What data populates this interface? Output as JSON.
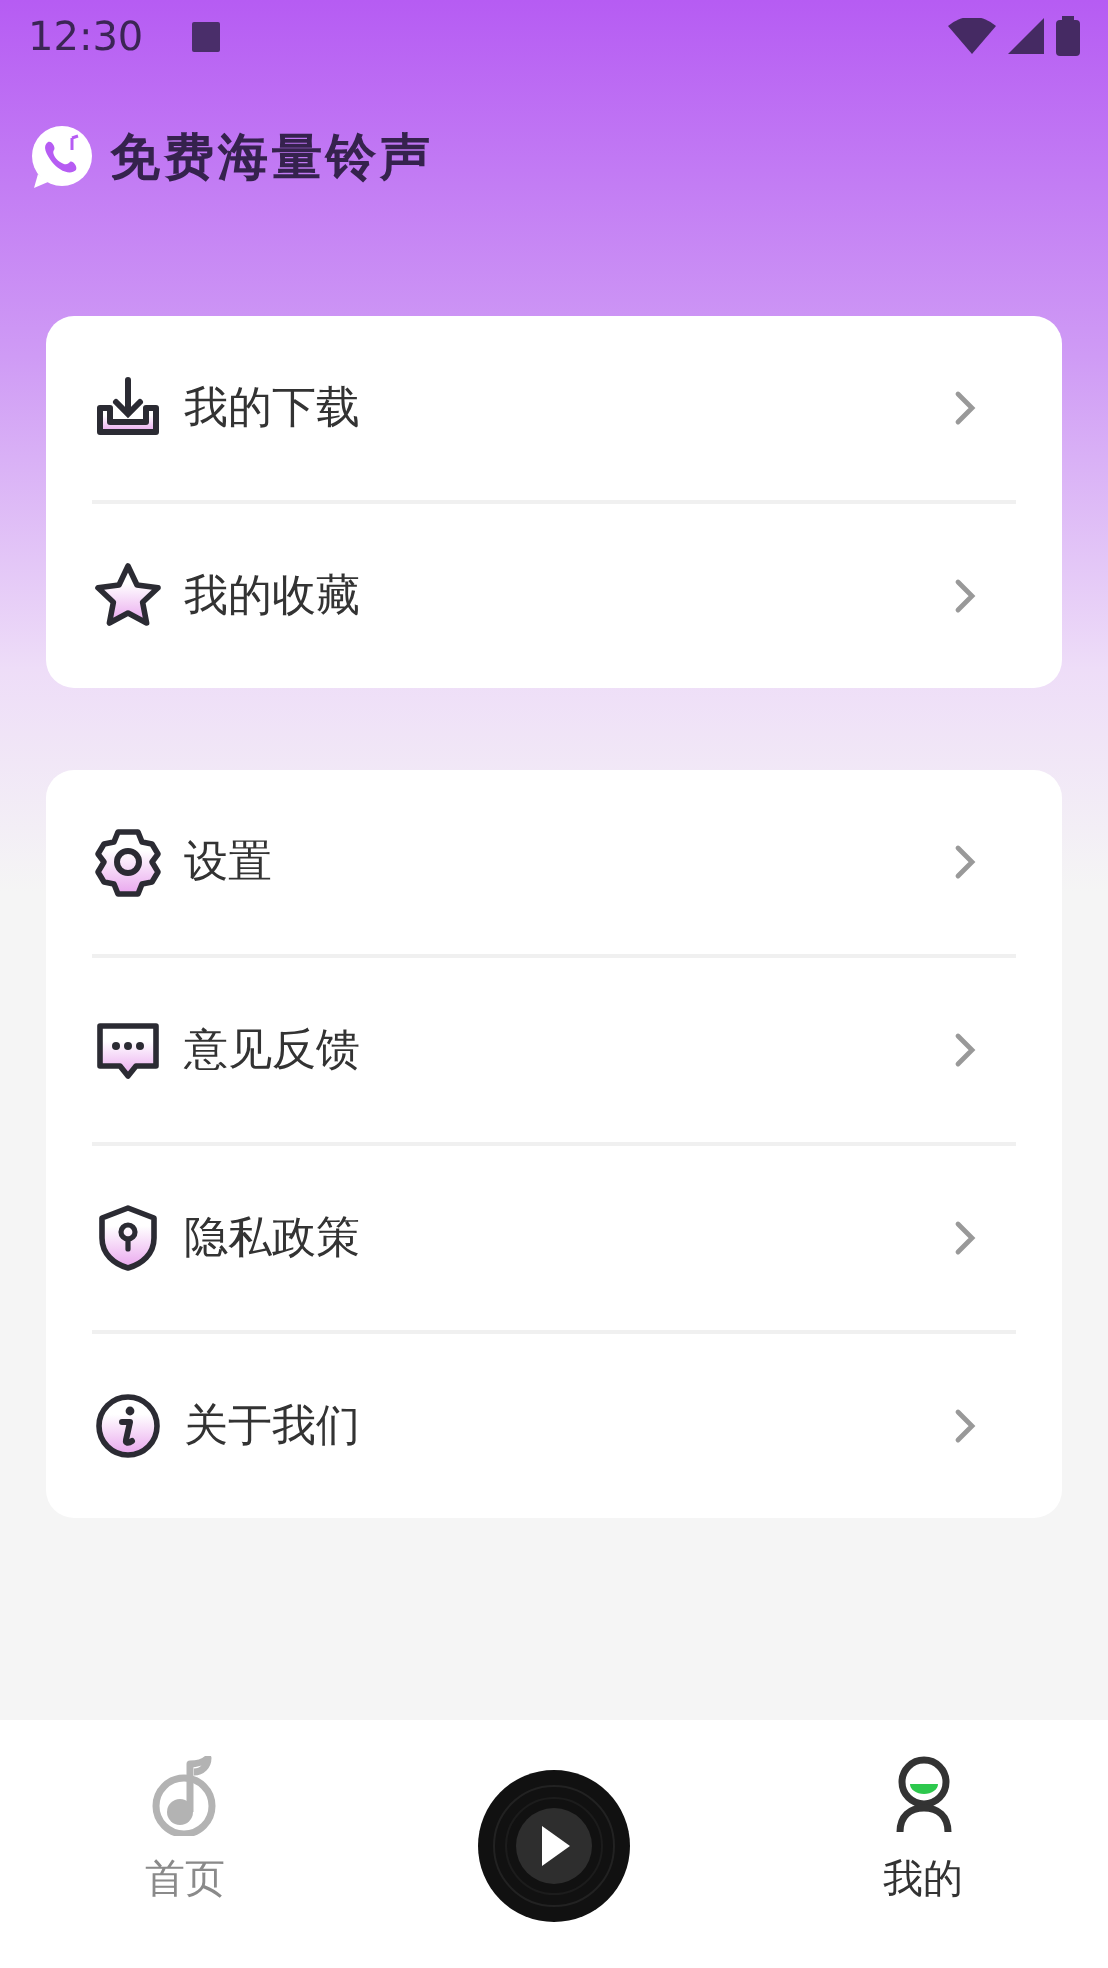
{
  "status_bar": {
    "time": "12:30"
  },
  "header": {
    "title": "免费海量铃声"
  },
  "groups": [
    {
      "items": [
        {
          "kind": "download",
          "label": "我的下载"
        },
        {
          "kind": "star",
          "label": "我的收藏"
        }
      ]
    },
    {
      "items": [
        {
          "kind": "gear",
          "label": "设置"
        },
        {
          "kind": "chat",
          "label": "意见反馈"
        },
        {
          "kind": "shield",
          "label": "隐私政策"
        },
        {
          "kind": "info",
          "label": "关于我们"
        }
      ]
    }
  ],
  "bottom_nav": [
    {
      "kind": "note",
      "label": "首页",
      "selected": false
    },
    {
      "kind": "player"
    },
    {
      "kind": "person",
      "label": "我的",
      "selected": true
    }
  ]
}
